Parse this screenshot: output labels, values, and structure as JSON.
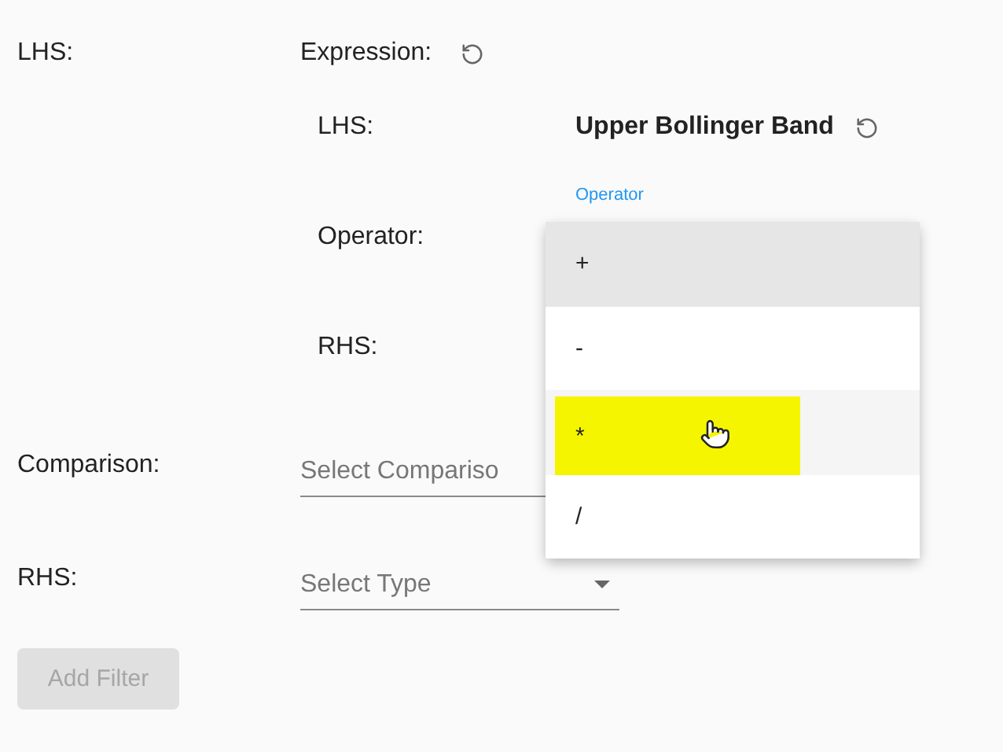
{
  "filter": {
    "lhs_label": "LHS:",
    "expression_label": "Expression:",
    "expression": {
      "lhs_label": "LHS:",
      "lhs_value": "Upper Bollinger Band",
      "operator_label": "Operator:",
      "operator_field_label": "Operator",
      "rhs_label": "RHS:"
    },
    "comparison_label": "Comparison:",
    "comparison_placeholder": "Select Compariso",
    "rhs_label": "RHS:",
    "rhs_placeholder": "Select Type",
    "button": {
      "label": "Add Filter",
      "disabled": true
    }
  },
  "operator_menu": [
    {
      "label": "+",
      "selected": true,
      "highlighted": false
    },
    {
      "label": "-",
      "selected": false,
      "highlighted": false
    },
    {
      "label": "*",
      "selected": false,
      "highlighted": true
    },
    {
      "label": "/",
      "selected": false,
      "highlighted": false
    }
  ]
}
